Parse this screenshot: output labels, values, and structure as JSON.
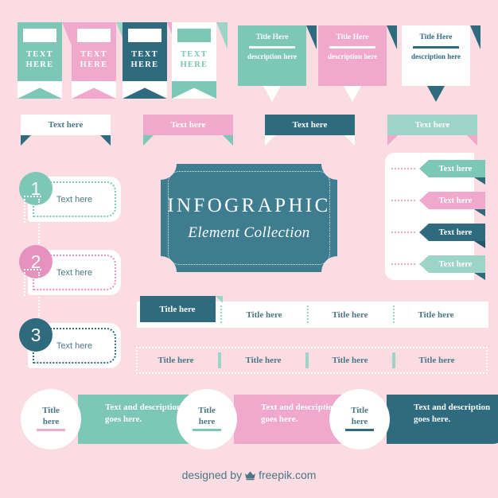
{
  "palette": {
    "background": "#FBDCE2",
    "mint": "#7CC7B5",
    "mint_light": "#9CD4C8",
    "pink": "#F0A8CC",
    "pink_mid": "#E592BE",
    "teal_dark": "#2E6B7E",
    "teal_shadow": "#23576B",
    "white": "#FFFFFF",
    "text_teal": "#4C7785"
  },
  "bookmarks": [
    {
      "label_line1": "TEXT",
      "label_line2": "HERE",
      "fill": "#7CC7B5",
      "bar": "#FFFFFF",
      "text": "#FFFFFF",
      "notch": "#FFFFFF",
      "fold": "#F0A8CC"
    },
    {
      "label_line1": "TEXT",
      "label_line2": "HERE",
      "fill": "#F0A8CC",
      "bar": "#FFFFFF",
      "text": "#FFFFFF",
      "notch": "#FFFFFF",
      "fold": "#9CD4C8"
    },
    {
      "label_line1": "TEXT",
      "label_line2": "HERE",
      "fill": "#2E6B7E",
      "bar": "#FFFFFF",
      "text": "#FFFFFF",
      "notch": "#FFFFFF",
      "fold": "#F0A8CC"
    },
    {
      "label_line1": "TEXT",
      "label_line2": "HERE",
      "fill": "#FFFFFF",
      "bar": "#7CC7B5",
      "text": "#7CC7B5",
      "notch": "#7CC7B5",
      "fold": "#9CD4C8"
    }
  ],
  "title_cards": [
    {
      "title": "Title Here",
      "description": "description here",
      "fill": "#7CC7B5",
      "text": "#FFFFFF",
      "rule": "#FFFFFF",
      "tail": "#FFFFFF",
      "fold": "#2E6B7E"
    },
    {
      "title": "Title Here",
      "description": "description here",
      "fill": "#F0A8CC",
      "text": "#FFFFFF",
      "rule": "#FFFFFF",
      "tail": "#FFFFFF",
      "fold": "#2E6B7E"
    },
    {
      "title": "Title Here",
      "description": "description here",
      "fill": "#FFFFFF",
      "text": "#2E6B7E",
      "rule": "#2E6B7E",
      "tail": "#2E6B7E",
      "fold": "#2E6B7E"
    }
  ],
  "ribbons": [
    {
      "label": "Text here",
      "fill": "#FFFFFF",
      "text": "#4C7785",
      "tail": "#2E6B7E"
    },
    {
      "label": "Text here",
      "fill": "#F0A8CC",
      "text": "#FFFFFF",
      "tail": "#7CC7B5"
    },
    {
      "label": "Text here",
      "fill": "#2E6B7E",
      "text": "#FFFFFF",
      "tail": "#FFFFFF"
    },
    {
      "label": "Text here",
      "fill": "#9CD4C8",
      "text": "#FFFFFF",
      "tail": "#F0A8CC"
    }
  ],
  "badge": {
    "title": "INFOGRAPHIC",
    "subtitle": "Element Collection",
    "fill": "#3E7D8F",
    "border": "#EAF5F4"
  },
  "steps": [
    {
      "number": "1",
      "label": "Text here",
      "color": "#7CC7B5"
    },
    {
      "number": "2",
      "label": "Text here",
      "color": "#E592BE"
    },
    {
      "number": "3",
      "label": "Text here",
      "color": "#2E6B7E"
    }
  ],
  "arrow_panel": {
    "rows": [
      {
        "label": "Text here",
        "fill": "#7CC7B5",
        "shadow": "#2E6B7E"
      },
      {
        "label": "Text here",
        "fill": "#F0A8CC",
        "shadow": "#2E6B7E"
      },
      {
        "label": "Text here",
        "fill": "#2E6B7E",
        "shadow": "#23576B"
      },
      {
        "label": "Text here",
        "fill": "#9CD4C8",
        "shadow": "#2E6B7E"
      }
    ]
  },
  "tab_bar": {
    "tabs": [
      {
        "label": "Title here",
        "active": true
      },
      {
        "label": "Title here",
        "active": false
      },
      {
        "label": "Title here",
        "active": false
      },
      {
        "label": "Title here",
        "active": false
      }
    ]
  },
  "dashed_bar": {
    "tabs": [
      {
        "label": "Title here"
      },
      {
        "label": "Title here"
      },
      {
        "label": "Title here"
      },
      {
        "label": "Title here"
      }
    ]
  },
  "bottom_cards": [
    {
      "title_line1": "Title",
      "title_line2": "here",
      "body": "Text and description goes here.",
      "fill": "#7CC7B5",
      "underline": "#F0A8CC"
    },
    {
      "title_line1": "Title",
      "title_line2": "here",
      "body": "Text and description goes here.",
      "fill": "#F0A8CC",
      "underline": "#7CC7B5"
    },
    {
      "title_line1": "Title",
      "title_line2": "here",
      "body": "Text and description goes here.",
      "fill": "#2E6B7E",
      "underline": "#2E6B7E"
    }
  ],
  "footer": {
    "prefix": "designed by",
    "brand": "freepik.com"
  }
}
